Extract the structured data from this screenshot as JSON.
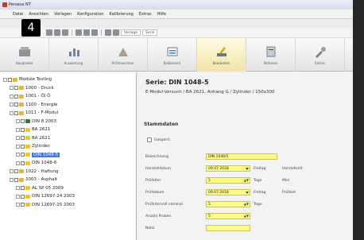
{
  "window": {
    "title": "Perseus NT"
  },
  "badge": "4",
  "menu": [
    "Datei",
    "Ansichten",
    "Vorlagen",
    "Konfiguration",
    "Kalibrierung",
    "Extras",
    "Hilfe"
  ],
  "toolbar_combos": [
    "Vorlage",
    "Serie"
  ],
  "ribbon": [
    {
      "label": "Hauptseite",
      "icon": "home-icon"
    },
    {
      "label": "Auswertung",
      "icon": "chart-icon"
    },
    {
      "label": "Prüfmaschine",
      "icon": "machine-icon"
    },
    {
      "label": "Kalibrieren",
      "icon": "calibrate-icon"
    },
    {
      "label": "Bearbeiten",
      "icon": "edit-icon",
      "active": true
    },
    {
      "label": "Aktionen",
      "icon": "actions-icon"
    },
    {
      "label": "Extras",
      "icon": "tools-icon"
    }
  ],
  "tree": [
    {
      "label": "Module Testing",
      "depth": 0,
      "icon": "folder"
    },
    {
      "label": "1000 - Druck",
      "depth": 1,
      "icon": "folder"
    },
    {
      "label": "1001 - Öl Ö",
      "depth": 1,
      "icon": "folder"
    },
    {
      "label": "1100 - Energie",
      "depth": 1,
      "icon": "folder"
    },
    {
      "label": "1011 - F-Modul",
      "depth": 1,
      "icon": "folder"
    },
    {
      "label": "DIN 8 2003",
      "depth": 2,
      "icon": "series"
    },
    {
      "label": "BA 2621",
      "depth": 2,
      "icon": "warn"
    },
    {
      "label": "BA 2621",
      "depth": 2,
      "icon": "warn"
    },
    {
      "label": "Zylinder",
      "depth": 2,
      "icon": "warn"
    },
    {
      "label": "DIN 1048-5",
      "depth": 2,
      "icon": "warn",
      "selected": true
    },
    {
      "label": "DIN 1048-6",
      "depth": 2,
      "icon": "warn"
    },
    {
      "label": "1022 - Haftung",
      "depth": 1,
      "icon": "folder"
    },
    {
      "label": "2003 - Asphalt",
      "depth": 1,
      "icon": "folder"
    },
    {
      "label": "AL SP 05 2009",
      "depth": 2,
      "icon": "warn"
    },
    {
      "label": "DIN 12697-24 2003",
      "depth": 2,
      "icon": "warn"
    },
    {
      "label": "DIN 12697-25 2003",
      "depth": 2,
      "icon": "warn"
    }
  ],
  "series": {
    "title": "Serie:  DIN 1048-5",
    "subtitle": "E-Modul-Versuch / BA 2621, Anhang G / Zylinder / 150x300",
    "section": "Stammdaten",
    "checkbox_label": "Gesperrt"
  },
  "fields": [
    {
      "label": "Bezeichnung",
      "value": "DIN 1048/5",
      "width": 90
    },
    {
      "label": "Herstelldatum",
      "value": "09.07.2018",
      "width": 56,
      "dropdown": true,
      "unit": "Freitag",
      "extra": "Herstellzeit"
    },
    {
      "label": "Prüfalter",
      "value": "5",
      "width": 56,
      "spinner": true,
      "unit": "Tage",
      "extra": "Mini"
    },
    {
      "label": "Prüfdatum",
      "value": "09.07.2018",
      "width": 56,
      "dropdown": true,
      "unit": "Freitag",
      "extra": "Prüfzeit"
    },
    {
      "label": "Prüfintervall nominal",
      "value": "5",
      "width": 56,
      "spinner": true,
      "unit": "Tage"
    },
    {
      "label": "Anzahl Proben",
      "value": "5",
      "width": 56,
      "spinner": true
    },
    {
      "label": "Notiz",
      "value": "",
      "width": 56
    }
  ]
}
